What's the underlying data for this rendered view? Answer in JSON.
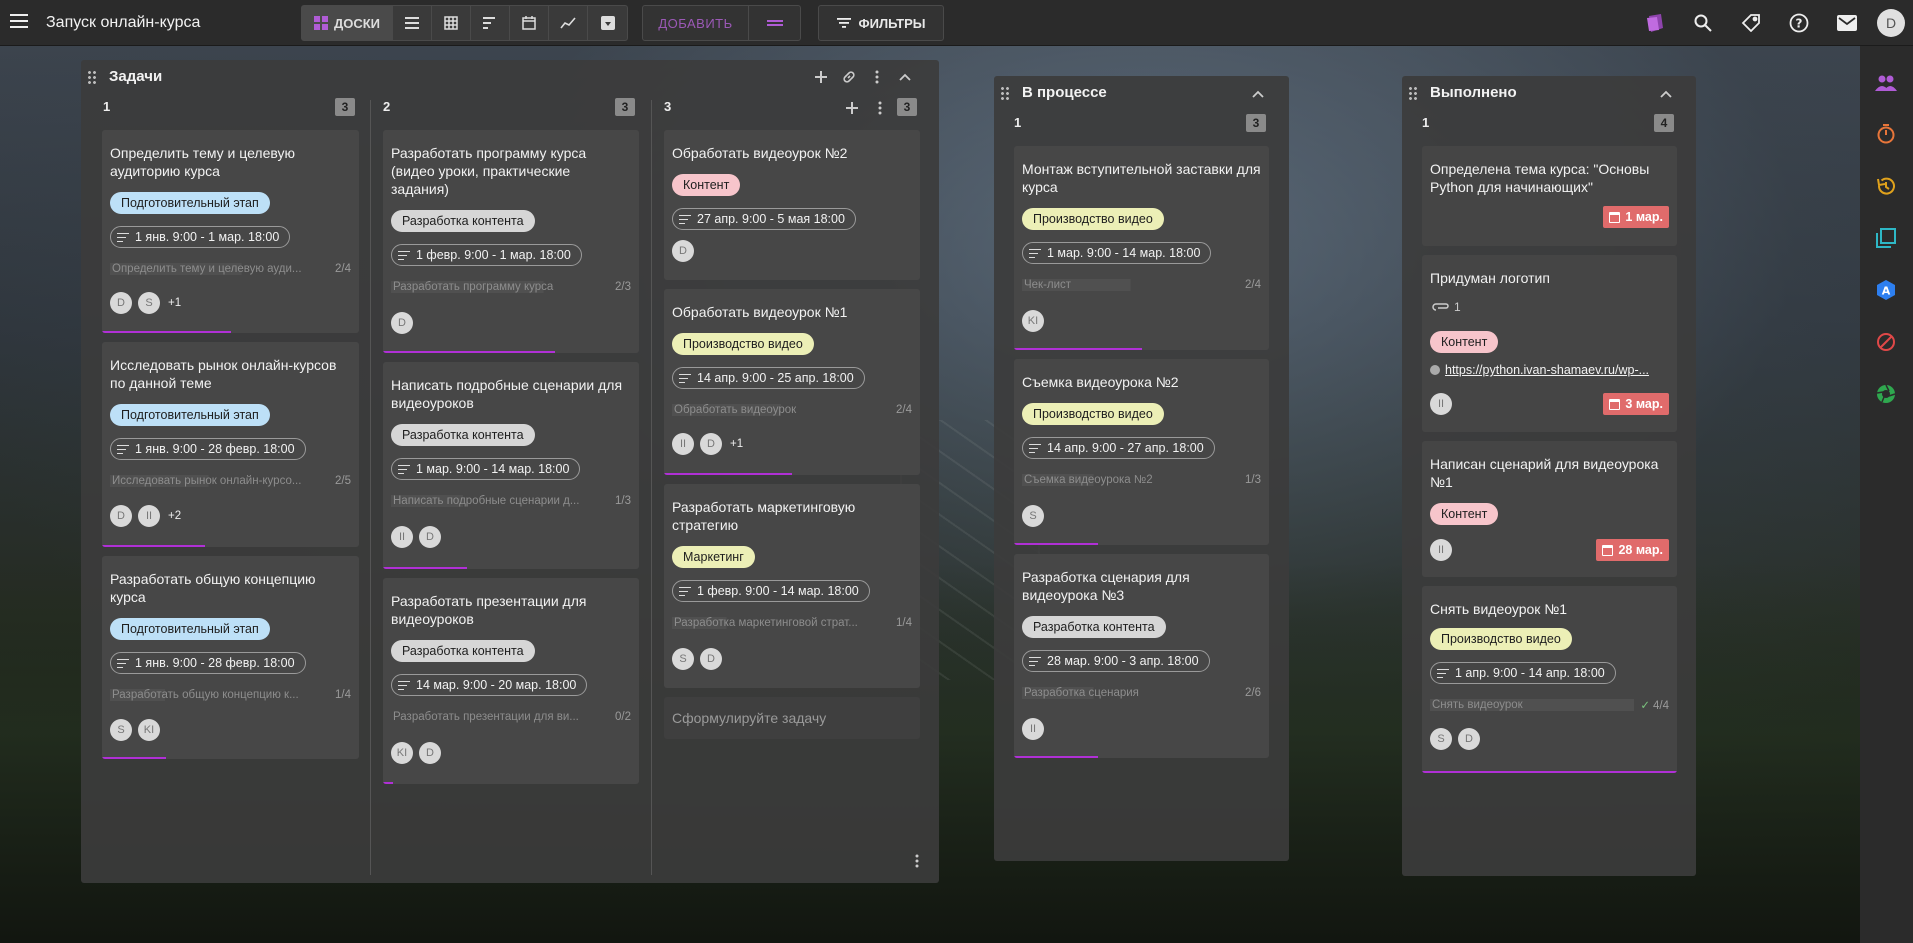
{
  "app": {
    "title": "Запуск онлайн-курса"
  },
  "toolbar": {
    "boards_label": "ДОСКИ",
    "add_label": "ДОБАВИТЬ",
    "filters_label": "ФИЛЬТРЫ",
    "user_initial": "D"
  },
  "boards": {
    "tasks": {
      "title": "Задачи",
      "columns": [
        {
          "name": "1",
          "count": "3",
          "cards": [
            {
              "title": "Определить тему и целевую аудиторию курса",
              "tag": "Подготовительный этап",
              "dates": "1 янв. 9:00 - 1 мар. 18:00",
              "checklist": "Определить тему и целевую ауди...",
              "progress": "2/4",
              "members": [
                "D",
                "S"
              ],
              "more": "+1"
            },
            {
              "title": "Исследовать рынок онлайн-курсов по данной теме",
              "tag": "Подготовительный этап",
              "dates": "1 янв. 9:00 - 28 февр. 18:00",
              "checklist": "Исследовать рынок онлайн-курсо...",
              "progress": "2/5",
              "members": [
                "D",
                "II"
              ],
              "more": "+2"
            },
            {
              "title": "Разработать общую концепцию курса",
              "tag": "Подготовительный этап",
              "dates": "1 янв. 9:00 - 28 февр. 18:00",
              "checklist": "Разработать общую концепцию к...",
              "progress": "1/4",
              "members": [
                "S",
                "KI"
              ]
            }
          ]
        },
        {
          "name": "2",
          "count": "3",
          "cards": [
            {
              "title": "Разработать программу курса (видео уроки, практические задания)",
              "tag": "Разработка контента",
              "dates": "1 февр. 9:00 - 1 мар. 18:00",
              "checklist": "Разработать программу курса",
              "progress": "2/3",
              "members": [
                "D"
              ]
            },
            {
              "title": "Написать подробные сценарии для видеоуроков",
              "tag": "Разработка контента",
              "dates": "1 мар. 9:00 - 14 мар. 18:00",
              "checklist": "Написать подробные сценарии д...",
              "progress": "1/3",
              "members": [
                "II",
                "D"
              ]
            },
            {
              "title": "Разработать презентации для видеоуроков",
              "tag": "Разработка контента",
              "dates": "14 мар. 9:00 - 20 мар. 18:00",
              "checklist": "Разработать презентации для ви...",
              "progress": "0/2",
              "members": [
                "KI",
                "D"
              ]
            }
          ]
        },
        {
          "name": "3",
          "count": "3",
          "cards": [
            {
              "title": "Обработать видеоурок №2",
              "tag": "Контент",
              "dates": "27 апр. 9:00 - 5 мая 18:00",
              "members": [
                "D"
              ]
            },
            {
              "title": "Обработать видеоурок №1",
              "tag": "Производство видео",
              "dates": "14 апр. 9:00 - 25 апр. 18:00",
              "checklist": "Обработать видеоурок",
              "progress": "2/4",
              "members": [
                "II",
                "D"
              ],
              "more": "+1"
            },
            {
              "title": "Разработать маркетинговую стратегию",
              "tag": "Маркетинг",
              "dates": "1 февр. 9:00 - 14 мар. 18:00",
              "checklist": "Разработка маркетинговой страт...",
              "progress": "1/4",
              "members": [
                "S",
                "D"
              ]
            }
          ],
          "add_placeholder": "Сформулируйте задачу"
        }
      ]
    },
    "inprogress": {
      "title": "В процессе",
      "columns": [
        {
          "name": "1",
          "count": "3",
          "cards": [
            {
              "title": "Монтаж вступительной заставки для курса",
              "tag": "Производство видео",
              "dates": "1 мар. 9:00 - 14 мар. 18:00",
              "checklist": "Чек-лист",
              "progress": "2/4",
              "members": [
                "KI"
              ]
            },
            {
              "title": "Съемка видеоурока №2",
              "tag": "Производство видео",
              "dates": "14 апр. 9:00 - 27 апр. 18:00",
              "checklist": "Съемка видеоурока №2",
              "progress": "1/3",
              "members": [
                "S"
              ]
            },
            {
              "title": "Разработка сценария для видеоурока №3",
              "tag": "Разработка контента",
              "dates": "28 мар. 9:00 - 3 апр. 18:00",
              "checklist": "Разработка сценария",
              "progress": "2/6",
              "members": [
                "II"
              ]
            }
          ]
        }
      ]
    },
    "done": {
      "title": "Выполнено",
      "columns": [
        {
          "name": "1",
          "count": "4",
          "cards": [
            {
              "title": "Определена тема курса: \"Основы Python для начинающих\"",
              "due": "1 мар."
            },
            {
              "title": "Придуман логотип",
              "attachments": "1",
              "tag": "Контент",
              "link": "https://python.ivan-shamaev.ru/wp-...",
              "members": [
                "II"
              ],
              "due": "3 мар."
            },
            {
              "title": "Написан сценарий для видеоурока №1",
              "tag": "Контент",
              "members": [
                "II"
              ],
              "due": "28 мар."
            },
            {
              "title": "Снять видеоурок №1",
              "tag": "Производство видео",
              "dates": "1 апр. 9:00 - 14 апр. 18:00",
              "checklist": "Снять видеоурок",
              "progress": "4/4",
              "members": [
                "S",
                "D"
              ]
            }
          ]
        }
      ]
    }
  },
  "colors": {
    "accent": "#b030d6",
    "due_overdue": "#e06b6b",
    "tag_preparation": "#bde0f7",
    "tag_content_dev": "#d6d6d6",
    "tag_content": "#f7c5cb",
    "tag_video": "#ecefb6"
  },
  "icons": {
    "topbar": [
      "menu-icon",
      "boards-icon",
      "list-icon",
      "table-icon",
      "gantt-icon",
      "calendar-icon",
      "chart-icon",
      "archive-icon",
      "filter-icon",
      "brand-icon",
      "search-icon",
      "tag-icon",
      "help-icon",
      "mail-icon"
    ],
    "rail": [
      "people-icon",
      "timer-icon",
      "history-icon",
      "layers-icon",
      "translate-icon",
      "block-icon",
      "shutter-icon"
    ]
  }
}
